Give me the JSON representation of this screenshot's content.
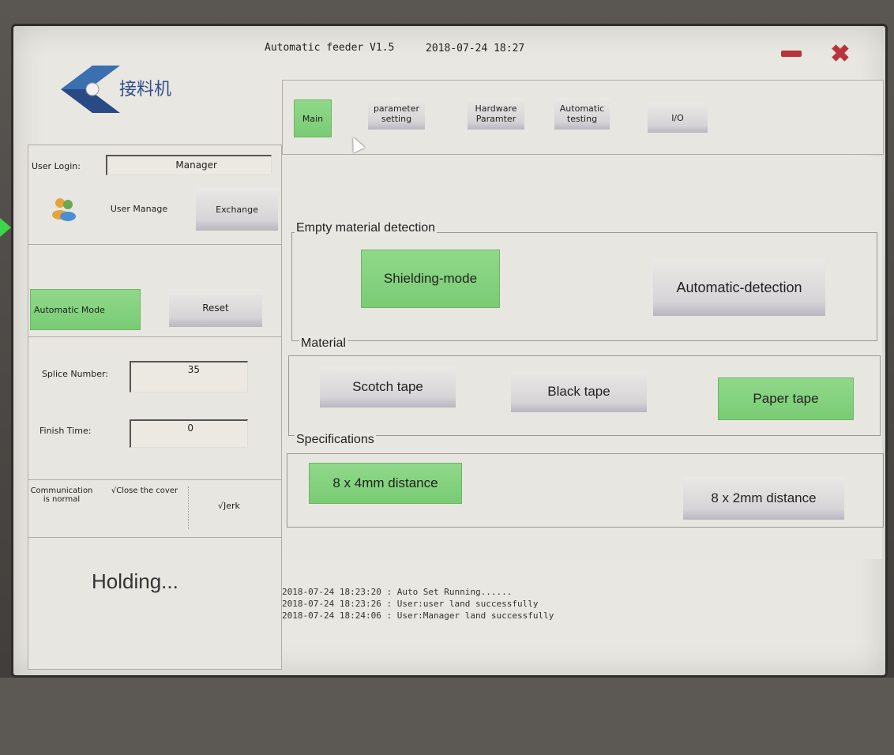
{
  "window": {
    "title": "Automatic feeder V1.5",
    "datetime": "2018-07-24  18:27"
  },
  "logo": {
    "text": "接料机",
    "icon": "logo-icon"
  },
  "tabs": [
    {
      "label": "Main",
      "active": true
    },
    {
      "label": "parameter setting",
      "active": false
    },
    {
      "label": "Hardware Paramter",
      "active": false
    },
    {
      "label": "Automatic testing",
      "active": false
    },
    {
      "label": "I/O",
      "active": false
    }
  ],
  "user": {
    "login_label": "User Login:",
    "login_value": "Manager",
    "manage_label": "User Manage",
    "exchange_label": "Exchange",
    "users_icon": "users-icon"
  },
  "mode": {
    "automatic_label": "Automatic Mode",
    "reset_label": "Reset"
  },
  "counts": {
    "splice_label": "Splice Number:",
    "splice_value": "35",
    "finish_label": "Finish Time:",
    "finish_value": "0"
  },
  "status": {
    "communication": "Communication is normal",
    "close_cover": "√Close the cover",
    "jerk": "√Jerk"
  },
  "holding_text": "Holding...",
  "groups": {
    "empty_detection": {
      "title": "Empty material detection",
      "shielding": "Shielding-mode",
      "automatic": "Automatic-detection"
    },
    "material": {
      "title": "Material",
      "scotch": "Scotch tape",
      "black": "Black tape",
      "paper": "Paper tape"
    },
    "specifications": {
      "title": "Specifications",
      "spec_8x4": "8 x 4mm distance",
      "spec_8x2": "8 x 2mm distance"
    }
  },
  "log": [
    "2018-07-24  18:23:20  :  Auto Set Running......",
    "2018-07-24  18:23:26  :  User:user land successfully",
    "2018-07-24  18:24:06  :  User:Manager land successfully"
  ],
  "colors": {
    "active_green": "#7fcf79",
    "close_red": "#b8343a",
    "logo_blue": "#2f4f8c"
  }
}
